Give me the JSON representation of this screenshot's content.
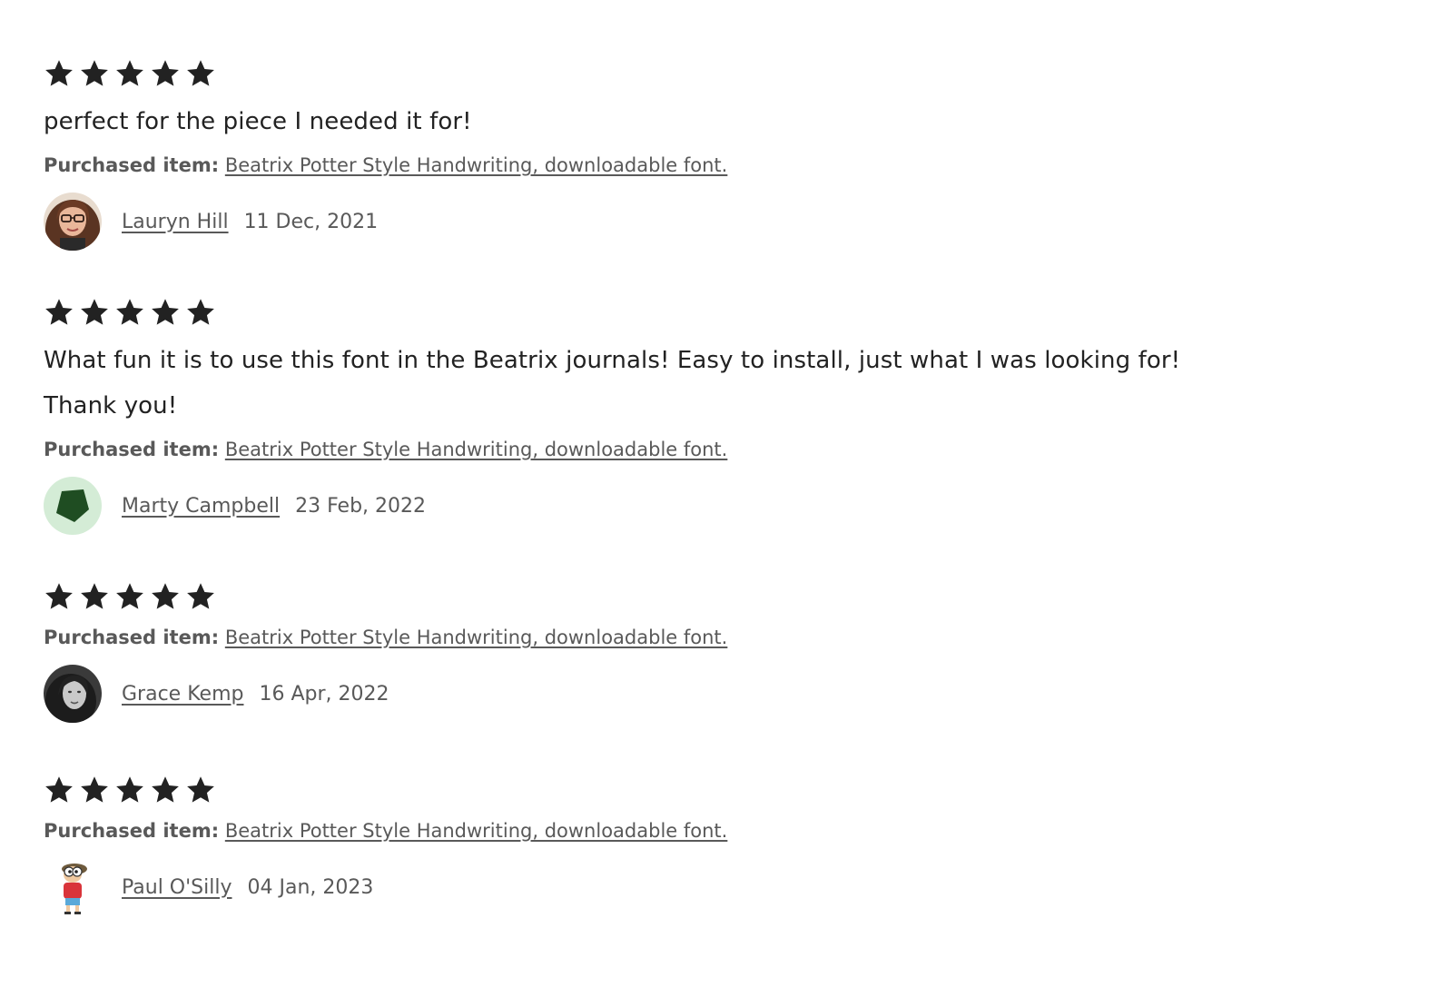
{
  "reviews": [
    {
      "rating": 5,
      "text": "perfect for the piece I needed it for!",
      "purchased_label": "Purchased item:",
      "item": "Beatrix Potter Style Handwriting, downloadable font.",
      "reviewer": "Lauryn Hill",
      "date": "11 Dec, 2021",
      "avatar_icon": "woman-with-glasses-photo"
    },
    {
      "rating": 5,
      "text": "What fun it is to use this font in the Beatrix journals! Easy to install, just what I was looking for! Thank you!",
      "purchased_label": "Purchased item:",
      "item": "Beatrix Potter Style Handwriting, downloadable font.",
      "reviewer": "Marty Campbell",
      "date": "23 Feb, 2022",
      "avatar_icon": "green-pentagon-default-avatar"
    },
    {
      "rating": 5,
      "purchased_label": "Purchased item:",
      "item": "Beatrix Potter Style Handwriting, downloadable font.",
      "reviewer": "Grace Kemp",
      "date": "16 Apr, 2022",
      "avatar_icon": "grayscale-portrait-photo"
    },
    {
      "rating": 5,
      "purchased_label": "Purchased item:",
      "item": "Beatrix Potter Style Handwriting, downloadable font.",
      "reviewer": "Paul O'Silly",
      "date": "04 Jan, 2023",
      "avatar_icon": "cartoon-character-avatar"
    }
  ],
  "colors": {
    "star": "#222222",
    "text": "#222222",
    "meta": "#595959",
    "avatar_bg_green": "#d4ecd6",
    "avatar_shape_green": "#1f4d22"
  }
}
